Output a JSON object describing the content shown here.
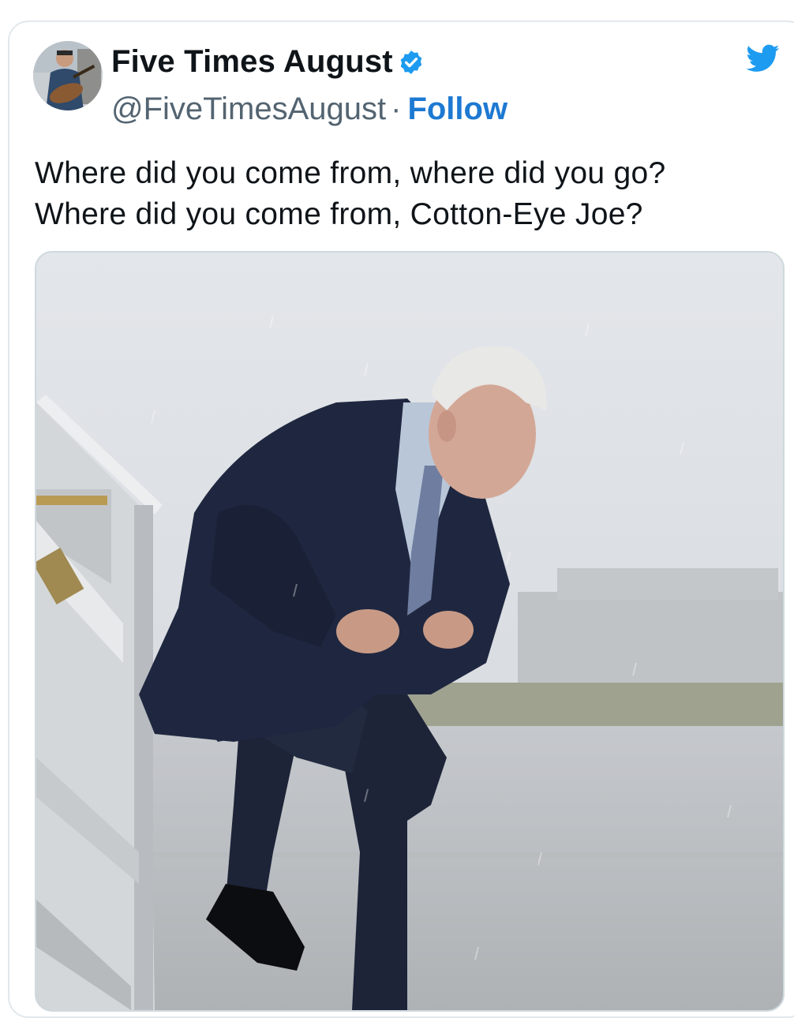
{
  "tweet": {
    "display_name": "Five Times August",
    "handle": "@FiveTimesAugust",
    "separator": "·",
    "follow_label": "Follow",
    "verified_icon": "verified-badge-icon",
    "brand_icon": "twitter-bird-icon",
    "text": "Where did you come from, where did you go?\nWhere did you come from, Cotton-Eye Joe?",
    "accent_color": "#1d9bf0",
    "follow_color": "#1d79d2"
  },
  "media": {
    "kind": "photo",
    "subject": "man in dark suit stepping off airplane stairs in the rain"
  }
}
